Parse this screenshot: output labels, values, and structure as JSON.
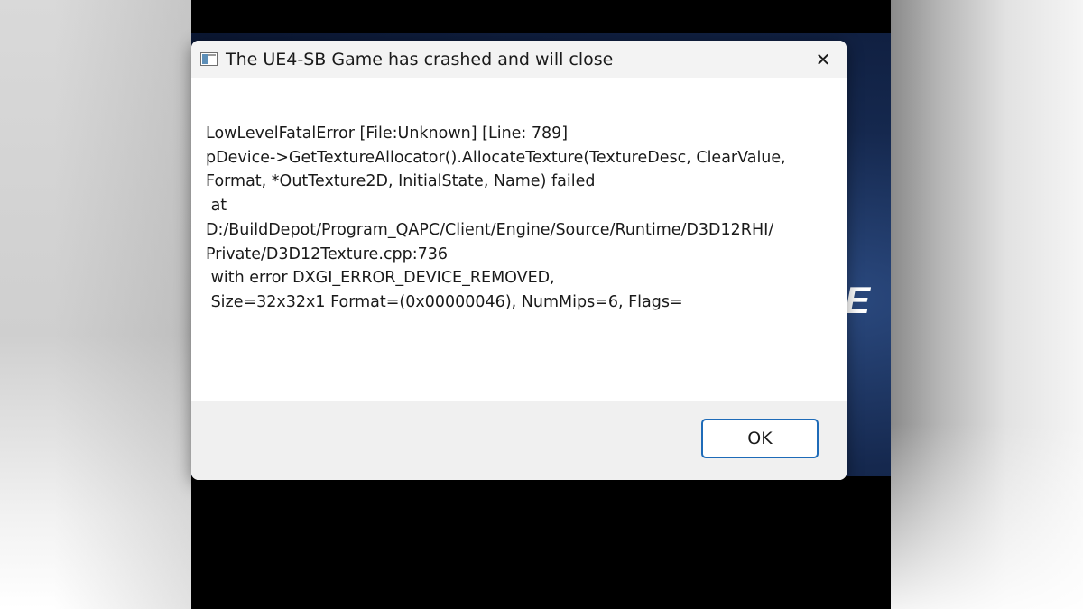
{
  "dialog": {
    "title": "The UE4-SB Game has crashed and will close",
    "close_glyph": "✕",
    "message_lines": [
      "LowLevelFatalError [File:Unknown] [Line: 789]",
      "pDevice->GetTextureAllocator().AllocateTexture(TextureDesc, ClearValue,",
      "Format, *OutTexture2D, InitialState, Name) failed",
      " at",
      "D:/BuildDepot/Program_QAPC/Client/Engine/Source/Runtime/D3D12RHI/",
      "Private/D3D12Texture.cpp:736",
      " with error DXGI_ERROR_DEVICE_REMOVED,",
      " Size=32x32x1 Format=(0x00000046), NumMips=6, Flags="
    ],
    "ok_label": "OK",
    "accent_color": "#1e6bb8",
    "icons": {
      "app": "application-window-icon",
      "close": "close-icon"
    }
  },
  "background": {
    "logo_fragment": "E"
  }
}
